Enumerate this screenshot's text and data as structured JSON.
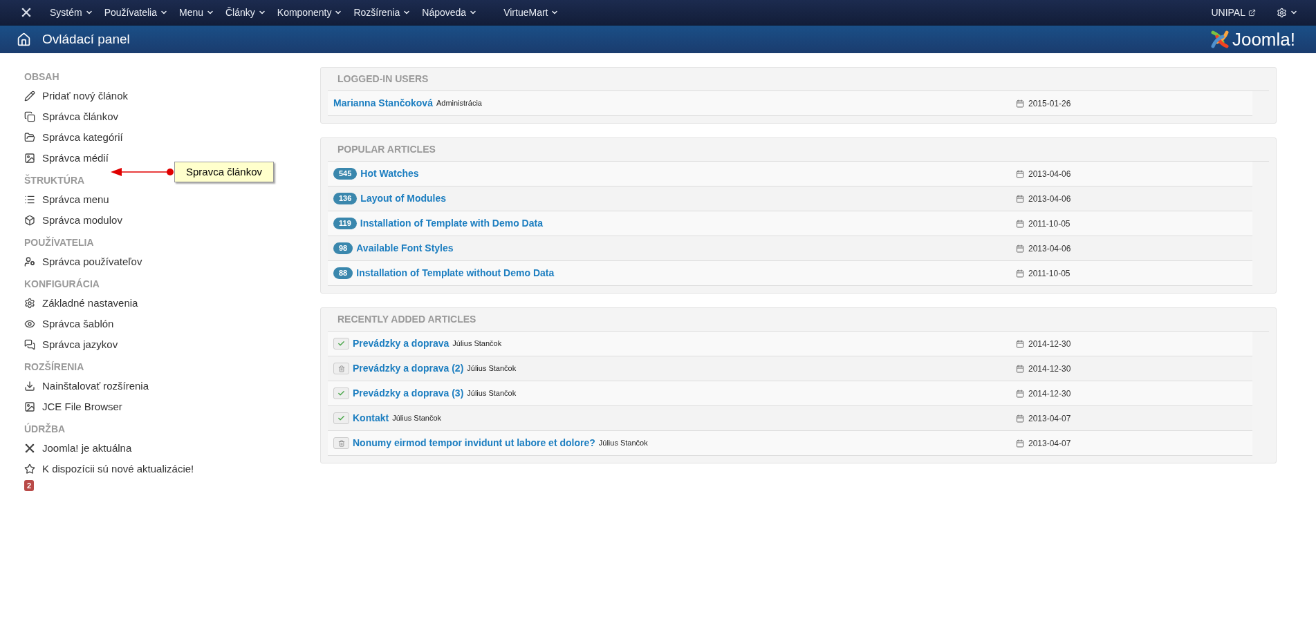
{
  "top_menu": {
    "items": [
      {
        "label": "Systém"
      },
      {
        "label": "Používatelia"
      },
      {
        "label": "Menu"
      },
      {
        "label": "Články"
      },
      {
        "label": "Komponenty"
      },
      {
        "label": "Rozšírenia"
      },
      {
        "label": "Nápoveda"
      },
      {
        "label": "VirtueMart"
      }
    ],
    "site_link": "UNIPAL"
  },
  "header": {
    "title": "Ovládací panel",
    "logo_text": "Joomla!"
  },
  "sidebar": {
    "sections": [
      {
        "title": "OBSAH",
        "items": [
          {
            "label": "Pridať nový článok"
          },
          {
            "label": "Správca článkov"
          },
          {
            "label": "Správca kategórií"
          },
          {
            "label": "Správca médií"
          }
        ]
      },
      {
        "title": "ŠTRUKTÚRA",
        "items": [
          {
            "label": "Správca menu"
          },
          {
            "label": "Správca modulov"
          }
        ]
      },
      {
        "title": "POUŽÍVATELIA",
        "items": [
          {
            "label": "Správca používateľov"
          }
        ]
      },
      {
        "title": "KONFIGURÁCIA",
        "items": [
          {
            "label": "Základné nastavenia"
          },
          {
            "label": "Správca šablón"
          },
          {
            "label": "Správca jazykov"
          }
        ]
      },
      {
        "title": "ROZŠÍRENIA",
        "items": [
          {
            "label": "Nainštalovať rozšírenia"
          },
          {
            "label": "JCE File Browser"
          }
        ]
      },
      {
        "title": "ÚDRŽBA",
        "items": [
          {
            "label": "Joomla! je aktuálna"
          },
          {
            "label": "K dispozícii sú nové aktualizácie!",
            "badge": "2"
          }
        ]
      }
    ]
  },
  "annotation": {
    "text": "Spravca článkov"
  },
  "logged_in_users": {
    "heading": "LOGGED-IN USERS",
    "rows": [
      {
        "name": "Marianna Stančoková",
        "role": "Administrácia",
        "date": "2015-01-26"
      }
    ]
  },
  "popular_articles": {
    "heading": "POPULAR ARTICLES",
    "rows": [
      {
        "hits": "545",
        "title": "Hot Watches",
        "date": "2013-04-06"
      },
      {
        "hits": "136",
        "title": "Layout of Modules",
        "date": "2013-04-06"
      },
      {
        "hits": "119",
        "title": "Installation of Template with Demo Data",
        "date": "2011-10-05"
      },
      {
        "hits": "98",
        "title": "Available Font Styles",
        "date": "2013-04-06"
      },
      {
        "hits": "88",
        "title": "Installation of Template without Demo Data",
        "date": "2011-10-05"
      }
    ]
  },
  "recently_added_articles": {
    "heading": "RECENTLY ADDED ARTICLES",
    "rows": [
      {
        "published": true,
        "title": "Prevádzky a doprava",
        "author": "Július Stančok",
        "date": "2014-12-30"
      },
      {
        "published": false,
        "title": "Prevádzky a doprava (2)",
        "author": "Július Stančok",
        "date": "2014-12-30"
      },
      {
        "published": true,
        "title": "Prevádzky a doprava (3)",
        "author": "Július Stančok",
        "date": "2014-12-30"
      },
      {
        "published": true,
        "title": "Kontakt",
        "author": "Július Stančok",
        "date": "2013-04-07"
      },
      {
        "published": false,
        "title": "Nonumy eirmod tempor invidunt ut labore et dolore?",
        "author": "Július Stančok",
        "date": "2013-04-07"
      }
    ]
  }
}
